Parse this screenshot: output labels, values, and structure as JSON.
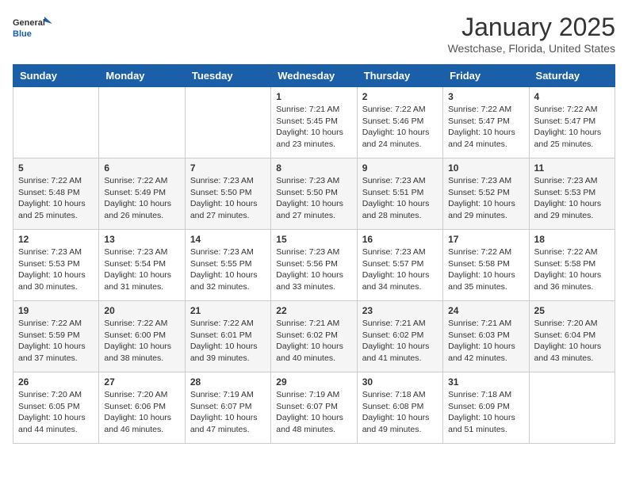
{
  "logo": {
    "general": "General",
    "blue": "Blue"
  },
  "header": {
    "title": "January 2025",
    "location": "Westchase, Florida, United States"
  },
  "days_of_week": [
    "Sunday",
    "Monday",
    "Tuesday",
    "Wednesday",
    "Thursday",
    "Friday",
    "Saturday"
  ],
  "weeks": [
    {
      "cells": [
        {
          "empty": true
        },
        {
          "empty": true
        },
        {
          "empty": true
        },
        {
          "day": "1",
          "info": "Sunrise: 7:21 AM\nSunset: 5:45 PM\nDaylight: 10 hours\nand 23 minutes."
        },
        {
          "day": "2",
          "info": "Sunrise: 7:22 AM\nSunset: 5:46 PM\nDaylight: 10 hours\nand 24 minutes."
        },
        {
          "day": "3",
          "info": "Sunrise: 7:22 AM\nSunset: 5:47 PM\nDaylight: 10 hours\nand 24 minutes."
        },
        {
          "day": "4",
          "info": "Sunrise: 7:22 AM\nSunset: 5:47 PM\nDaylight: 10 hours\nand 25 minutes."
        }
      ]
    },
    {
      "cells": [
        {
          "day": "5",
          "info": "Sunrise: 7:22 AM\nSunset: 5:48 PM\nDaylight: 10 hours\nand 25 minutes."
        },
        {
          "day": "6",
          "info": "Sunrise: 7:22 AM\nSunset: 5:49 PM\nDaylight: 10 hours\nand 26 minutes."
        },
        {
          "day": "7",
          "info": "Sunrise: 7:23 AM\nSunset: 5:50 PM\nDaylight: 10 hours\nand 27 minutes."
        },
        {
          "day": "8",
          "info": "Sunrise: 7:23 AM\nSunset: 5:50 PM\nDaylight: 10 hours\nand 27 minutes."
        },
        {
          "day": "9",
          "info": "Sunrise: 7:23 AM\nSunset: 5:51 PM\nDaylight: 10 hours\nand 28 minutes."
        },
        {
          "day": "10",
          "info": "Sunrise: 7:23 AM\nSunset: 5:52 PM\nDaylight: 10 hours\nand 29 minutes."
        },
        {
          "day": "11",
          "info": "Sunrise: 7:23 AM\nSunset: 5:53 PM\nDaylight: 10 hours\nand 29 minutes."
        }
      ]
    },
    {
      "cells": [
        {
          "day": "12",
          "info": "Sunrise: 7:23 AM\nSunset: 5:53 PM\nDaylight: 10 hours\nand 30 minutes."
        },
        {
          "day": "13",
          "info": "Sunrise: 7:23 AM\nSunset: 5:54 PM\nDaylight: 10 hours\nand 31 minutes."
        },
        {
          "day": "14",
          "info": "Sunrise: 7:23 AM\nSunset: 5:55 PM\nDaylight: 10 hours\nand 32 minutes."
        },
        {
          "day": "15",
          "info": "Sunrise: 7:23 AM\nSunset: 5:56 PM\nDaylight: 10 hours\nand 33 minutes."
        },
        {
          "day": "16",
          "info": "Sunrise: 7:23 AM\nSunset: 5:57 PM\nDaylight: 10 hours\nand 34 minutes."
        },
        {
          "day": "17",
          "info": "Sunrise: 7:22 AM\nSunset: 5:58 PM\nDaylight: 10 hours\nand 35 minutes."
        },
        {
          "day": "18",
          "info": "Sunrise: 7:22 AM\nSunset: 5:58 PM\nDaylight: 10 hours\nand 36 minutes."
        }
      ]
    },
    {
      "cells": [
        {
          "day": "19",
          "info": "Sunrise: 7:22 AM\nSunset: 5:59 PM\nDaylight: 10 hours\nand 37 minutes."
        },
        {
          "day": "20",
          "info": "Sunrise: 7:22 AM\nSunset: 6:00 PM\nDaylight: 10 hours\nand 38 minutes."
        },
        {
          "day": "21",
          "info": "Sunrise: 7:22 AM\nSunset: 6:01 PM\nDaylight: 10 hours\nand 39 minutes."
        },
        {
          "day": "22",
          "info": "Sunrise: 7:21 AM\nSunset: 6:02 PM\nDaylight: 10 hours\nand 40 minutes."
        },
        {
          "day": "23",
          "info": "Sunrise: 7:21 AM\nSunset: 6:02 PM\nDaylight: 10 hours\nand 41 minutes."
        },
        {
          "day": "24",
          "info": "Sunrise: 7:21 AM\nSunset: 6:03 PM\nDaylight: 10 hours\nand 42 minutes."
        },
        {
          "day": "25",
          "info": "Sunrise: 7:20 AM\nSunset: 6:04 PM\nDaylight: 10 hours\nand 43 minutes."
        }
      ]
    },
    {
      "cells": [
        {
          "day": "26",
          "info": "Sunrise: 7:20 AM\nSunset: 6:05 PM\nDaylight: 10 hours\nand 44 minutes."
        },
        {
          "day": "27",
          "info": "Sunrise: 7:20 AM\nSunset: 6:06 PM\nDaylight: 10 hours\nand 46 minutes."
        },
        {
          "day": "28",
          "info": "Sunrise: 7:19 AM\nSunset: 6:07 PM\nDaylight: 10 hours\nand 47 minutes."
        },
        {
          "day": "29",
          "info": "Sunrise: 7:19 AM\nSunset: 6:07 PM\nDaylight: 10 hours\nand 48 minutes."
        },
        {
          "day": "30",
          "info": "Sunrise: 7:18 AM\nSunset: 6:08 PM\nDaylight: 10 hours\nand 49 minutes."
        },
        {
          "day": "31",
          "info": "Sunrise: 7:18 AM\nSunset: 6:09 PM\nDaylight: 10 hours\nand 51 minutes."
        },
        {
          "empty": true
        }
      ]
    }
  ]
}
